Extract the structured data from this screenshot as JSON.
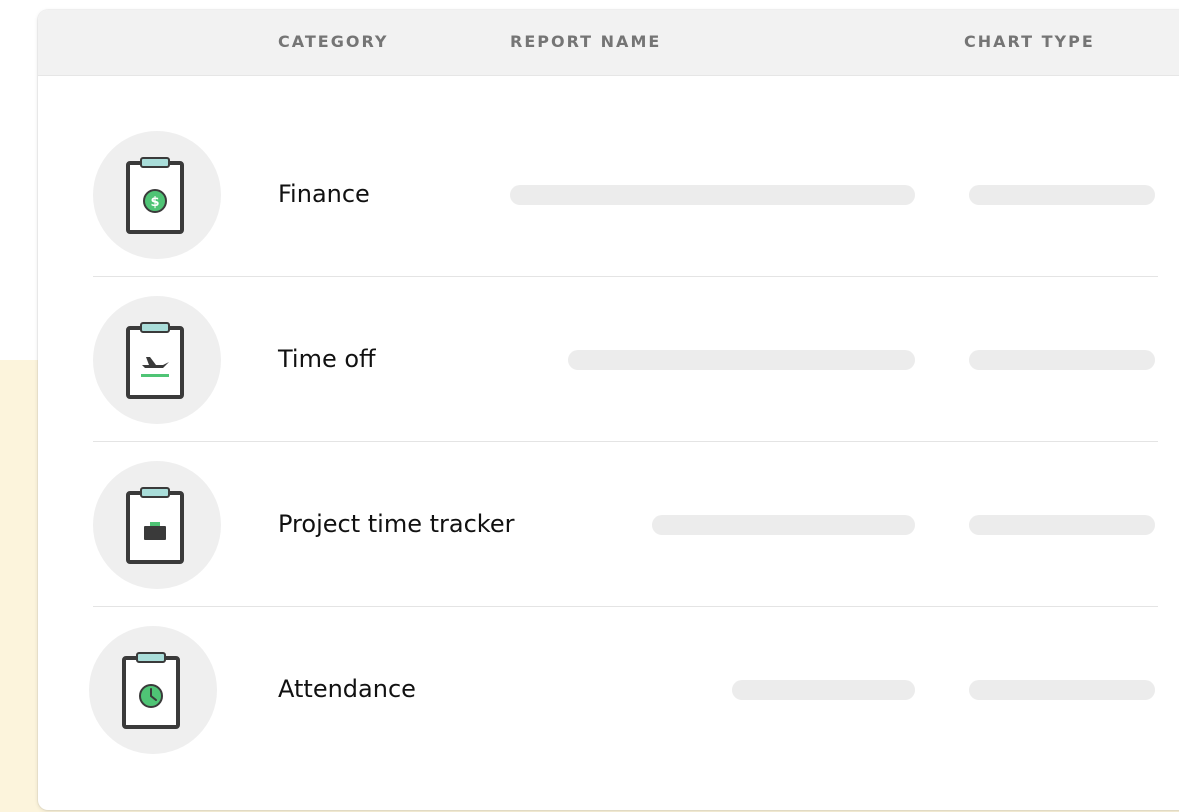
{
  "table": {
    "headers": {
      "category": "CATEGORY",
      "report_name": "REPORT NAME",
      "chart_type": "CHART TYPE"
    },
    "rows": [
      {
        "category": "Finance",
        "icon": "finance-clipboard-icon"
      },
      {
        "category": "Time off",
        "icon": "time-off-clipboard-icon"
      },
      {
        "category": "Project time tracker",
        "icon": "project-clipboard-icon"
      },
      {
        "category": "Attendance",
        "icon": "attendance-clipboard-icon"
      }
    ]
  },
  "colors": {
    "accent_green": "#4fc475",
    "clip_teal": "#a9ddd9",
    "outline_dark": "#3a3a3a",
    "backdrop_cream": "#fcf4dc"
  }
}
